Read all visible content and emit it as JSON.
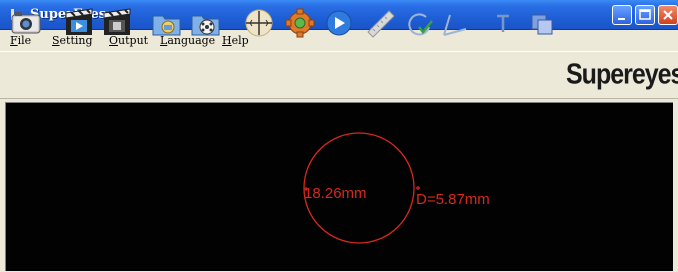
{
  "window": {
    "title": "SuperEyes"
  },
  "menu": [
    "File",
    "Setting",
    "Output",
    "Language",
    "Help"
  ],
  "toolbar": {
    "icons": [
      "camera-icon",
      "video-record-icon",
      "video-stop-icon",
      "open-folder-icon",
      "video-folder-icon",
      "crosshair-icon",
      "settings-gear-icon",
      "play-icon",
      "ruler-icon",
      "circle-measure-icon",
      "angle-measure-icon",
      "text-tool-icon",
      "color-overlay-icon"
    ],
    "brand": "Supereyes"
  },
  "measurements": {
    "radius_label": "18.26mm",
    "diameter_label": "D=5.87mm"
  },
  "colors": {
    "title_bar": "#1f5fd6",
    "measure": "#d8281c",
    "video_bg": "#020202"
  }
}
